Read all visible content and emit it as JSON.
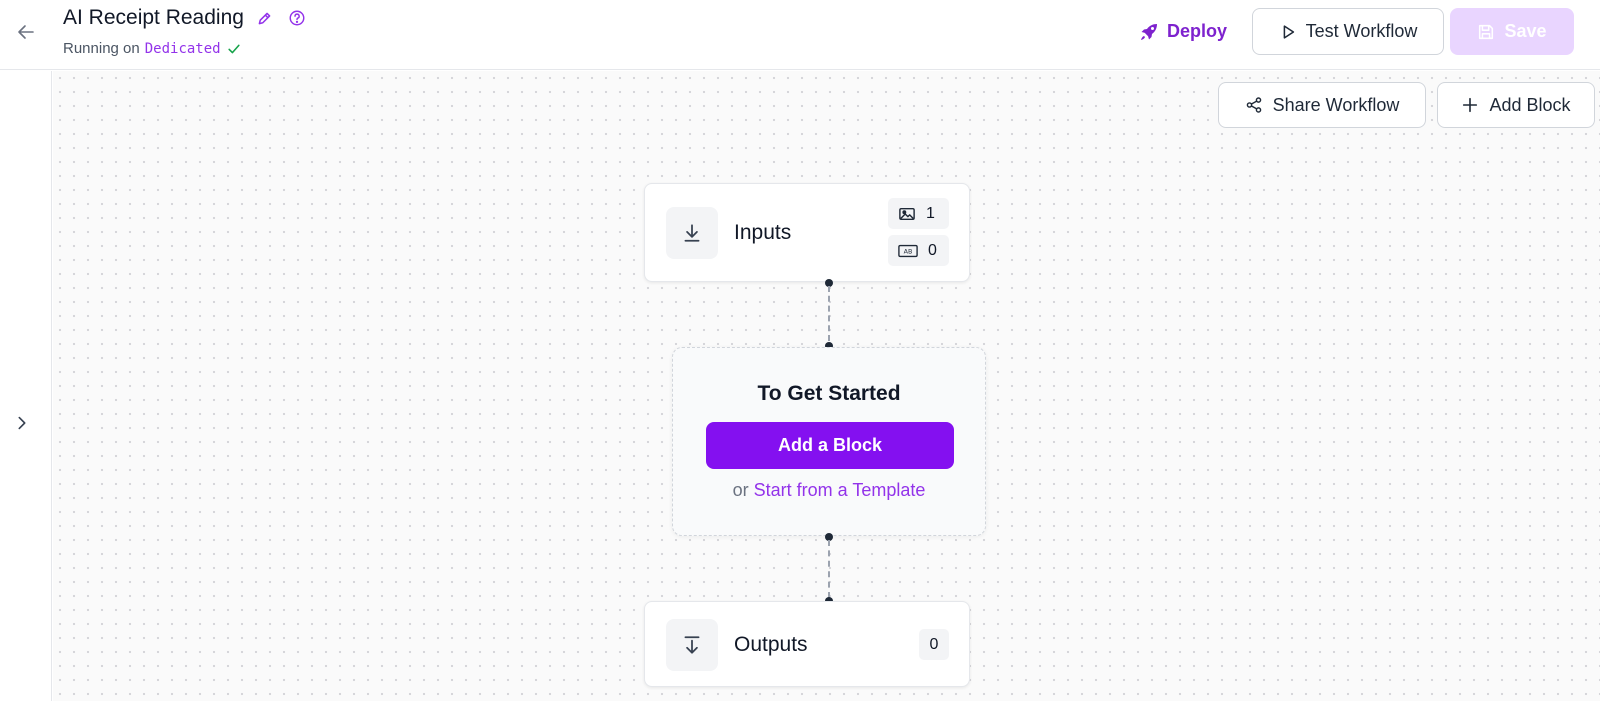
{
  "header": {
    "title": "AI Receipt Reading",
    "running_prefix": "Running on",
    "runtime": "Dedicated",
    "deploy_label": "Deploy",
    "test_label": "Test Workflow",
    "save_label": "Save"
  },
  "canvas": {
    "share_label": "Share Workflow",
    "add_block_label": "Add Block"
  },
  "inputs_node": {
    "label": "Inputs",
    "image_count": "1",
    "text_count": "0"
  },
  "start": {
    "title": "To Get Started",
    "button_label": "Add a Block",
    "or_text": "or",
    "template_link": "Start from a Template"
  },
  "outputs_node": {
    "label": "Outputs",
    "count": "0"
  },
  "colors": {
    "accent": "#8410f0",
    "accent_text": "#7e22ce",
    "save_disabled_bg": "#e9d5ff",
    "success": "#16a34a"
  },
  "icons": [
    "back-arrow-icon",
    "pencil-icon",
    "help-circle-icon",
    "check-icon",
    "rocket-icon",
    "play-icon",
    "save-icon",
    "chevron-right-icon",
    "share-icon",
    "plus-icon",
    "download-icon",
    "image-icon",
    "text-field-icon",
    "output-icon"
  ]
}
